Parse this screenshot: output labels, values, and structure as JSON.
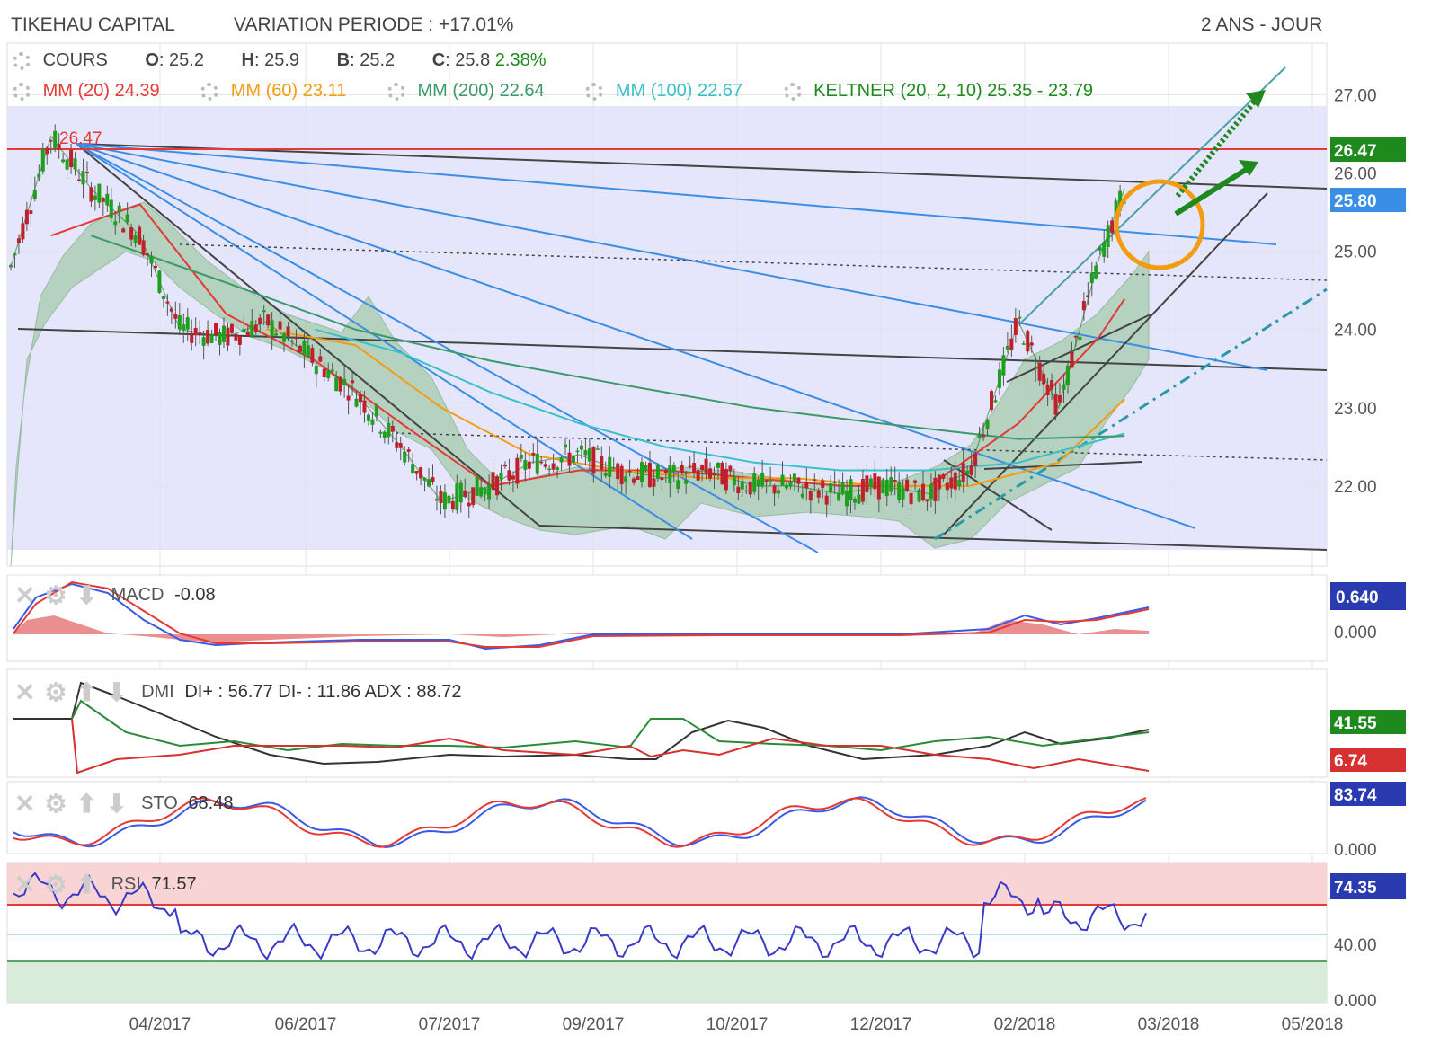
{
  "header": {
    "company": "TIKEHAU CAPITAL",
    "variation": "VARIATION PERIODE : +17.01%",
    "period": "2 ANS - JOUR"
  },
  "legend": {
    "cours": {
      "label": "COURS",
      "o_label": "O",
      "o": "25.2",
      "h_label": "H",
      "h": "25.9",
      "b_label": "B",
      "b": "25.2",
      "c_label": "C",
      "c": "25.8",
      "change": "2.38%"
    },
    "mm20": {
      "label": "MM (20)",
      "value": "24.39",
      "color": "#e53935"
    },
    "mm60": {
      "label": "MM (60)",
      "value": "23.11",
      "color": "#f39c12"
    },
    "mm200": {
      "label": "MM (200)",
      "value": "22.64",
      "color": "#3a9a6a"
    },
    "mm100": {
      "label": "MM (100)",
      "value": "22.67",
      "color": "#39c0c8"
    },
    "keltner": {
      "label": "KELTNER (20, 2, 10)",
      "value": "25.35 - 23.79",
      "color": "#1e8a1e"
    }
  },
  "panels": {
    "macd": {
      "label": "MACD",
      "value": "-0.08",
      "badge": "0.640",
      "axis0": "0.000"
    },
    "dmi": {
      "label": "DMI",
      "values": "DI+ : 56.77 DI- : 11.86 ADX : 88.72",
      "badge_green": "41.55",
      "badge_red": "6.74"
    },
    "sto": {
      "label": "STO",
      "value": "68.48",
      "badge": "83.74",
      "axis0": "0.000"
    },
    "rsi": {
      "label": "RSI",
      "value": "71.57",
      "badge": "74.35",
      "axis40": "40.00",
      "axis0": "0.000"
    }
  },
  "price_badges": {
    "resistance": "26.47",
    "last": "25.80",
    "peak_label": "26.47"
  },
  "chart_data": {
    "type": "line",
    "title": "TIKEHAU CAPITAL",
    "x_tick_labels": [
      "04/2017",
      "06/2017",
      "07/2017",
      "09/2017",
      "10/2017",
      "12/2017",
      "02/2018",
      "03/2018",
      "05/2018"
    ],
    "y_tick_labels": [
      "27.00",
      "26.00",
      "25.00",
      "24.00",
      "23.00",
      "22.00"
    ],
    "ylim": [
      21.0,
      27.2
    ],
    "grid": true,
    "series": [
      {
        "name": "COURS",
        "color": "#2a7a2a",
        "x": [
          "2017-02-15",
          "2017-03-01",
          "2017-03-15",
          "2017-04-01",
          "2017-04-15",
          "2017-05-01",
          "2017-05-15",
          "2017-06-01",
          "2017-06-15",
          "2017-07-01",
          "2017-07-15",
          "2017-08-01",
          "2017-08-15",
          "2017-09-01",
          "2017-09-15",
          "2017-10-01",
          "2017-10-15",
          "2017-11-01",
          "2017-11-15",
          "2017-12-01",
          "2017-12-15",
          "2018-01-01",
          "2018-01-15",
          "2018-02-01",
          "2018-02-15",
          "2018-03-01",
          "2018-03-10"
        ],
        "values": [
          24.8,
          26.47,
          25.8,
          25.2,
          24.0,
          23.9,
          24.1,
          23.6,
          23.2,
          22.5,
          21.8,
          22.0,
          22.3,
          22.4,
          22.2,
          22.1,
          22.2,
          22.0,
          22.0,
          21.9,
          22.0,
          21.9,
          22.2,
          24.1,
          23.0,
          24.9,
          25.8
        ]
      },
      {
        "name": "MM (20)",
        "color": "#e53935",
        "x": [
          "2017-03-01",
          "2017-04-01",
          "2017-05-01",
          "2017-06-01",
          "2017-07-01",
          "2017-08-01",
          "2017-09-01",
          "2017-10-01",
          "2017-11-01",
          "2017-12-01",
          "2018-01-01",
          "2018-02-01",
          "2018-03-01",
          "2018-03-10"
        ],
        "values": [
          25.2,
          25.6,
          24.2,
          23.6,
          22.8,
          22.0,
          22.2,
          22.2,
          22.1,
          22.0,
          22.0,
          22.8,
          23.9,
          24.39
        ]
      },
      {
        "name": "MM (60)",
        "color": "#f39c12",
        "x": [
          "2017-05-15",
          "2017-06-15",
          "2017-07-15",
          "2017-08-15",
          "2017-09-15",
          "2017-10-15",
          "2017-11-15",
          "2017-12-15",
          "2018-01-15",
          "2018-02-15",
          "2018-03-10"
        ],
        "values": [
          24.0,
          23.8,
          23.0,
          22.4,
          22.2,
          22.1,
          22.1,
          22.0,
          22.0,
          22.3,
          23.11
        ]
      },
      {
        "name": "MM (100)",
        "color": "#39c0c8",
        "x": [
          "2017-06-01",
          "2017-07-01",
          "2017-08-01",
          "2017-09-01",
          "2017-10-01",
          "2017-11-01",
          "2017-12-01",
          "2018-01-01",
          "2018-02-01",
          "2018-03-10"
        ],
        "values": [
          24.0,
          23.7,
          23.2,
          22.8,
          22.5,
          22.3,
          22.2,
          22.2,
          22.3,
          22.67
        ]
      },
      {
        "name": "MM (200)",
        "color": "#3a9a6a",
        "x": [
          "2017-03-15",
          "2017-05-01",
          "2017-06-15",
          "2017-08-01",
          "2017-09-15",
          "2017-11-01",
          "2017-12-15",
          "2018-02-01",
          "2018-03-10"
        ],
        "values": [
          25.2,
          24.6,
          24.0,
          23.6,
          23.3,
          23.0,
          22.8,
          22.6,
          22.64
        ]
      }
    ]
  }
}
